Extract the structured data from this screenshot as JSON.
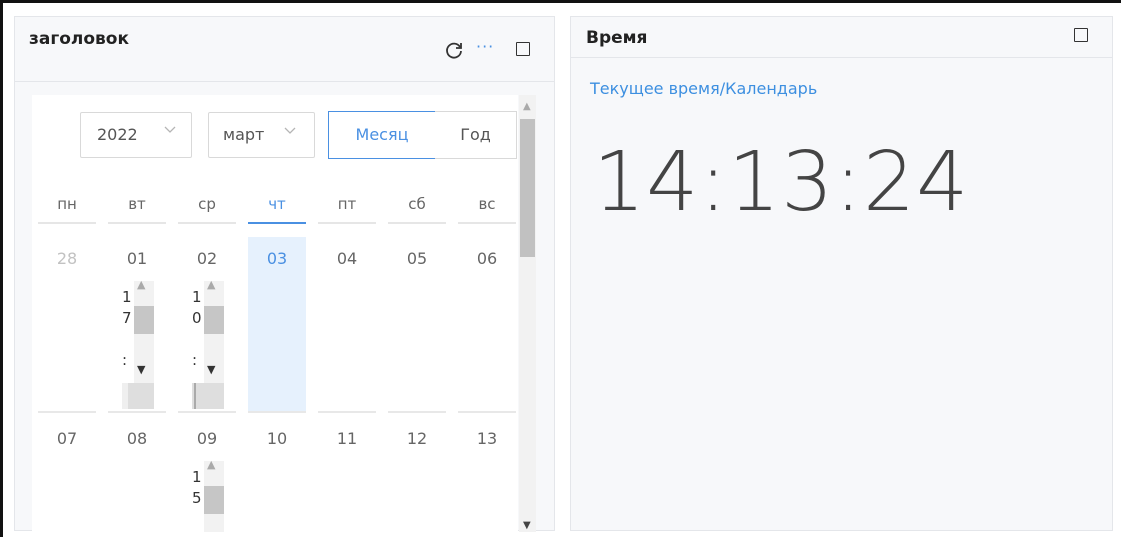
{
  "left_card": {
    "title": "заголовок",
    "icons": [
      "refresh-icon",
      "more-icon",
      "maximize-icon"
    ],
    "more_glyph": "···",
    "calendar": {
      "year_value": "2022",
      "month_value": "март",
      "mode_month": "Месяц",
      "mode_year": "Год",
      "weekdays": [
        "пн",
        "вт",
        "ср",
        "чт",
        "пт",
        "сб",
        "вс"
      ],
      "today_index": 3,
      "week1": [
        "28",
        "01",
        "02",
        "03",
        "04",
        "05",
        "06"
      ],
      "week2": [
        "07",
        "08",
        "09",
        "10",
        "11",
        "12",
        "13"
      ],
      "event_01": [
        "1",
        "7",
        ":"
      ],
      "event_02": [
        "1",
        "0",
        ":"
      ],
      "event_09": [
        "1",
        "5",
        ":"
      ]
    },
    "accent_color": "#4a90e2"
  },
  "right_card": {
    "title": "Время",
    "link": "Текущее время/Календарь",
    "time": "14:13:24"
  }
}
